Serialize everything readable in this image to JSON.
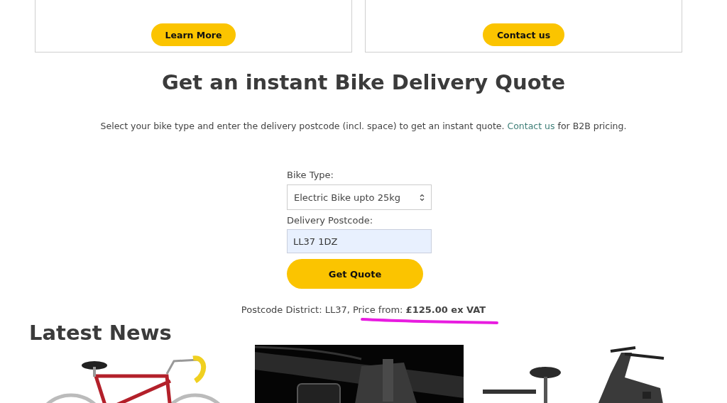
{
  "cards": [
    {
      "button": "Learn More"
    },
    {
      "button": "Contact us"
    }
  ],
  "quote": {
    "title": "Get an instant Bike Delivery Quote",
    "intro": {
      "before": "Select your bike type and enter the delivery postcode (incl. space) to get an instant quote.",
      "link": "Contact us",
      "after": "for B2B pricing."
    },
    "bike_type": {
      "label": "Bike Type:",
      "value": "Electric Bike upto 25kg"
    },
    "postcode": {
      "label": "Delivery Postcode:",
      "value": "LL37 1DZ"
    },
    "button": "Get Quote",
    "result": "Postcode District: LL37, Price from: **£125.00 ex VAT**",
    "result_underlined": true
  },
  "news": {
    "title": "Latest News"
  }
}
